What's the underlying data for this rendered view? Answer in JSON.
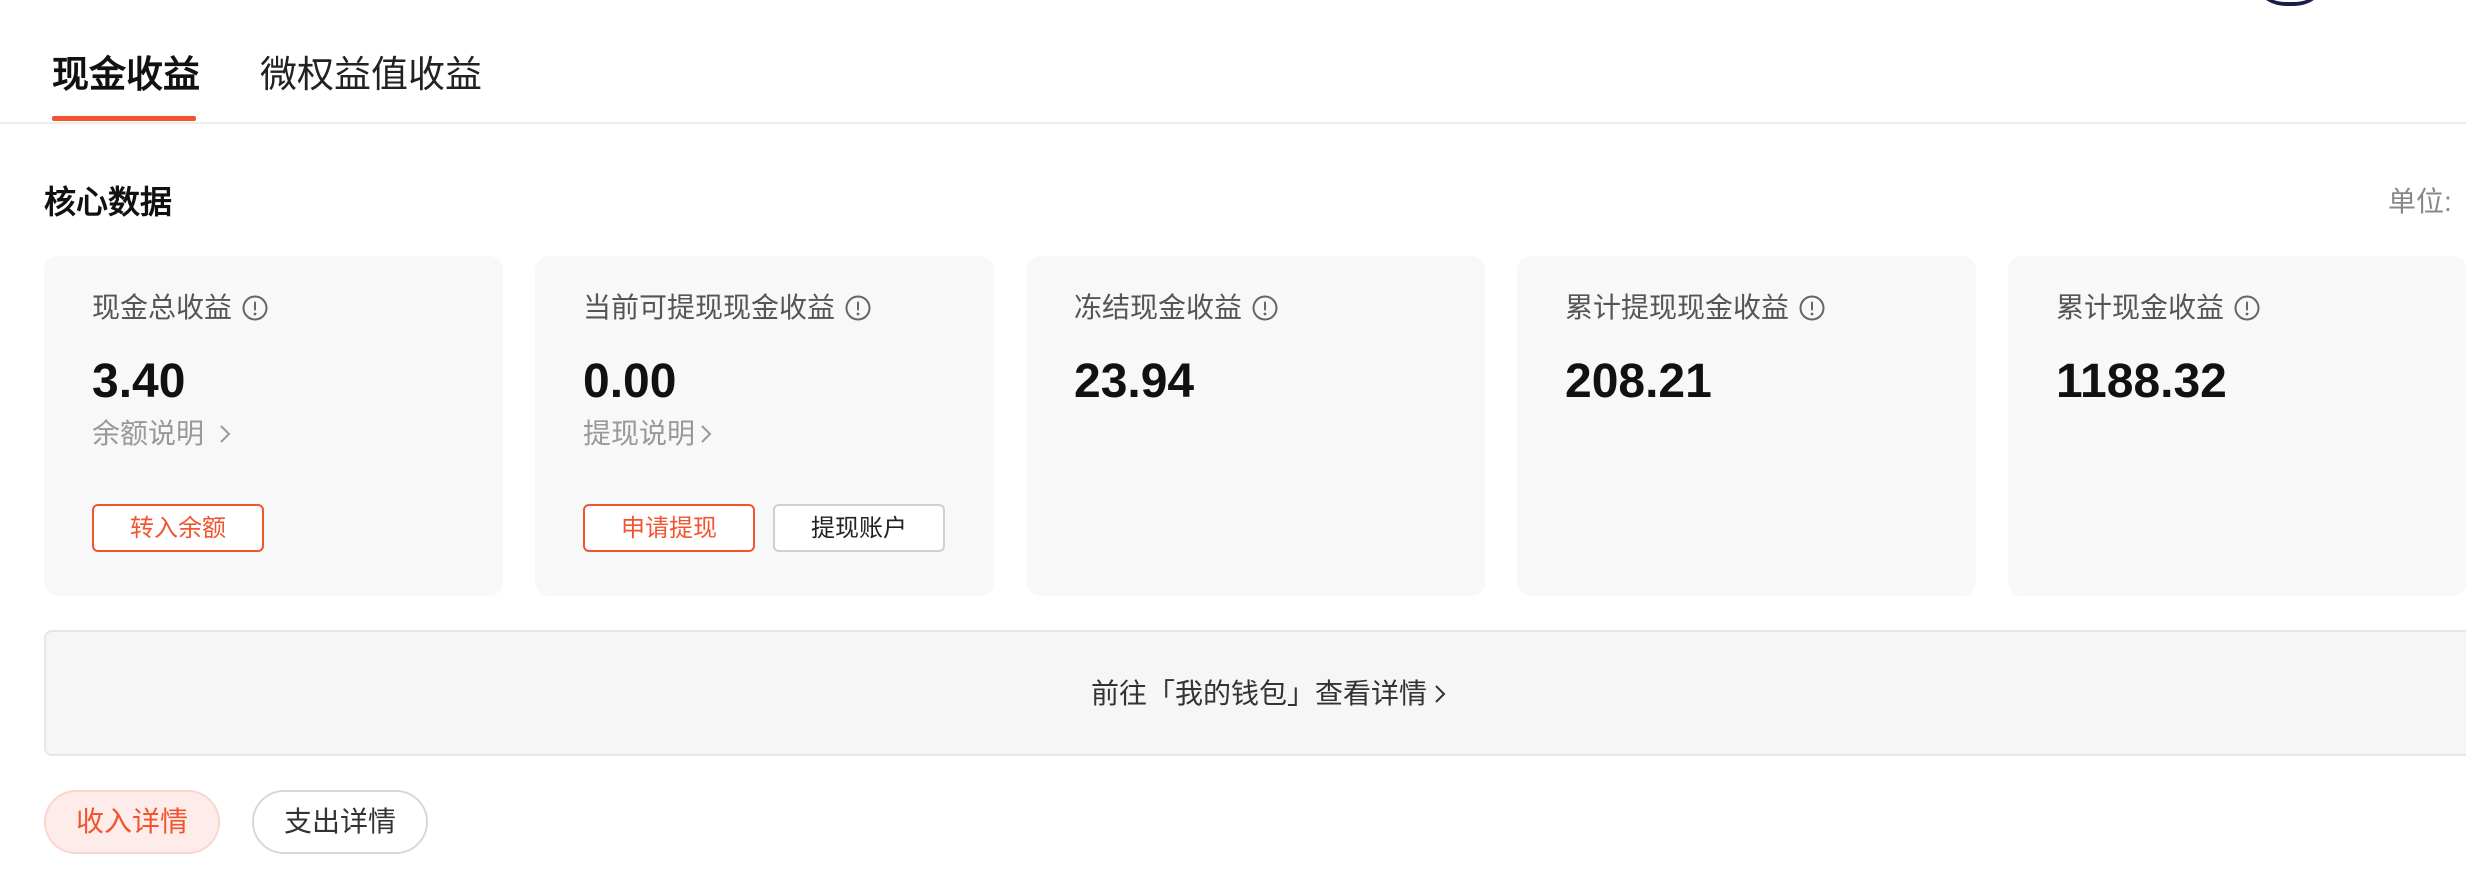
{
  "tabs": [
    {
      "label": "现金收益",
      "active": true
    },
    {
      "label": "微权益值收益",
      "active": false
    }
  ],
  "section": {
    "title": "核心数据",
    "unit_label": "单位:"
  },
  "cards": [
    {
      "title": "现金总收益",
      "value": "3.40",
      "link": "余额说明",
      "buttons": [
        {
          "label": "转入余额",
          "style": "orange"
        }
      ]
    },
    {
      "title": "当前可提现现金收益",
      "value": "0.00",
      "link": "提现说明",
      "buttons": [
        {
          "label": "申请提现",
          "style": "orange"
        },
        {
          "label": "提现账户",
          "style": "grey"
        }
      ]
    },
    {
      "title": "冻结现金收益",
      "value": "23.94"
    },
    {
      "title": "累计提现现金收益",
      "value": "208.21"
    },
    {
      "title": "累计现金收益",
      "value": "1188.32"
    }
  ],
  "wallet_link": "前往「我的钱包」查看详情",
  "detail_tabs": [
    {
      "label": "收入详情",
      "active": true
    },
    {
      "label": "支出详情",
      "active": false
    }
  ],
  "colors": {
    "accent": "#f2542f",
    "card_bg": "#f8f8f8",
    "pill_active_bg": "#fdecea"
  },
  "icons": {
    "info": "info-circle-icon",
    "chevron": "chevron-right-icon"
  }
}
